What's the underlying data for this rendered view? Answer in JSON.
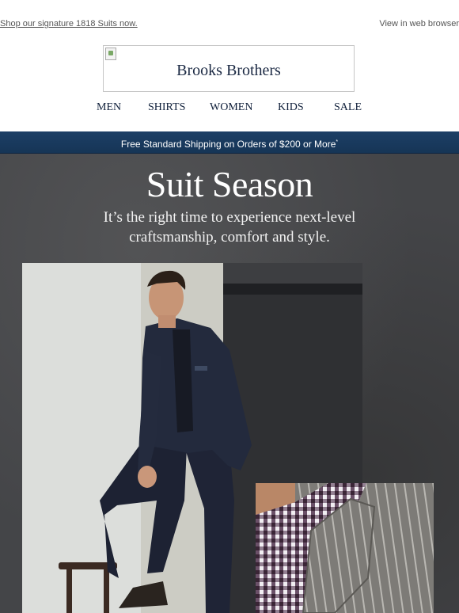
{
  "preheader": {
    "promo_link": "Shop our signature 1818 Suits now.",
    "web_link": "View in web browser"
  },
  "logo": {
    "alt_text": "Brooks Brothers"
  },
  "nav": {
    "items": [
      "MEN",
      "SHIRTS",
      "WOMEN",
      "KIDS",
      "SALE"
    ]
  },
  "shipping_banner": {
    "text": "Free Standard Shipping on Orders of $200 or More",
    "footnote_mark": "*"
  },
  "hero": {
    "title": "Suit Season",
    "subtitle": "It’s the right time to experience next-level craftsmanship, comfort and style."
  },
  "colors": {
    "brand_navy": "#0f1f3a",
    "banner_blue": "#1c3f66",
    "hero_bg": "#444548"
  }
}
